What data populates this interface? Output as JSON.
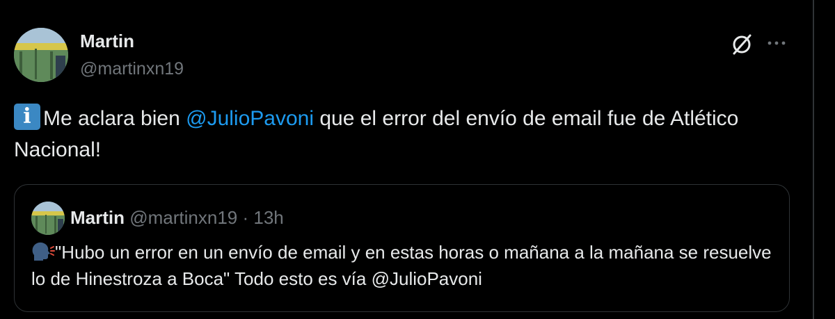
{
  "author": {
    "display_name": "Martin",
    "handle": "@martinxn19"
  },
  "tweet": {
    "emoji": "info-icon",
    "text_before_mention": "Me aclara bien ",
    "mention": "@JulioPavoni",
    "text_after_mention": " que el error del envío de email fue de Atlético Nacional!"
  },
  "quoted_tweet": {
    "display_name": "Martin",
    "handle": "@martinxn19",
    "separator": "·",
    "time": "13h",
    "emoji": "speaking-head-icon",
    "text_before_mention": "\"Hubo un error en un envío de email y en estas horas o mañana a la mañana se resuelve lo de Hinestroza a Boca\" Todo esto es vía ",
    "mention": "@JulioPavoni"
  },
  "icons": {
    "grok": "grok-icon",
    "more": "more-options-icon"
  },
  "colors": {
    "background": "#000000",
    "text_primary": "#e7e9ea",
    "text_secondary": "#71767b",
    "link": "#1d9bf0",
    "border": "#2f3336"
  }
}
